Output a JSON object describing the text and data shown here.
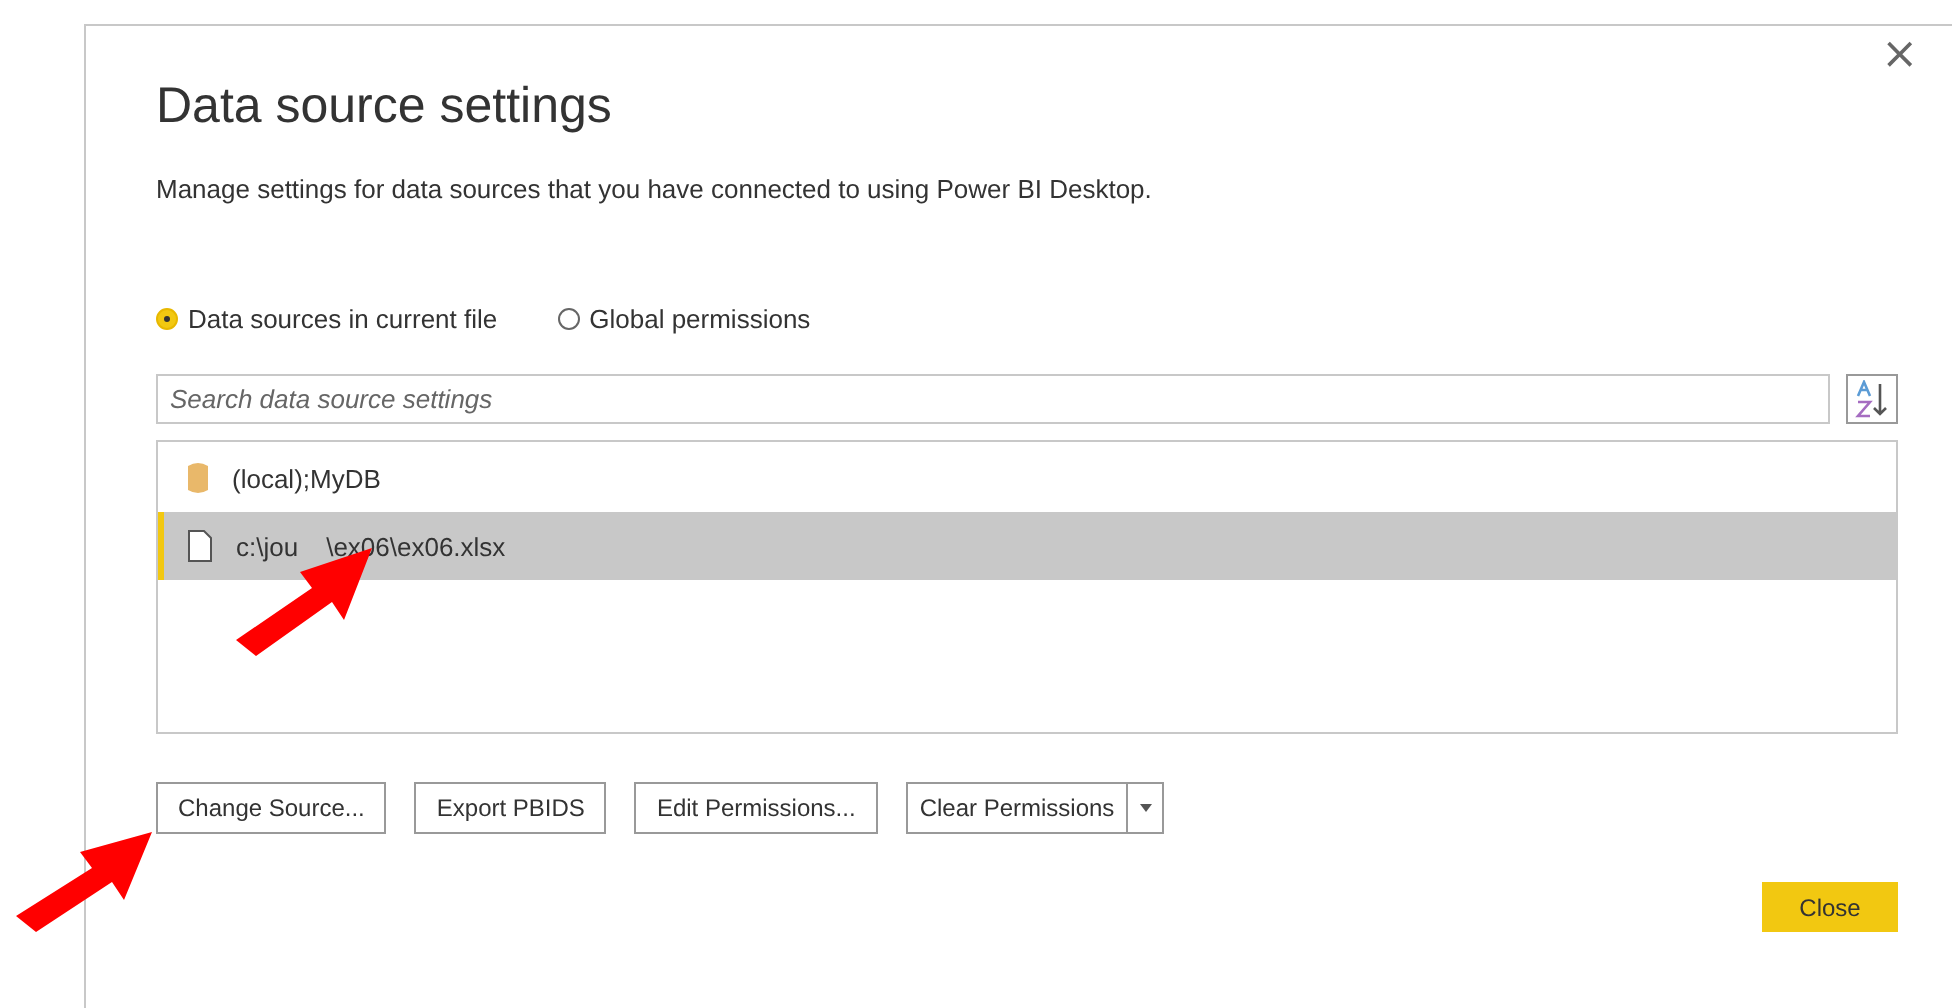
{
  "dialog": {
    "title": "Data source settings",
    "close_glyph": "×",
    "description": "Manage settings for data sources that you have connected to using Power BI Desktop."
  },
  "scope_options": [
    {
      "label": "Data sources in current file",
      "selected": true
    },
    {
      "label": "Global permissions",
      "selected": false
    }
  ],
  "search": {
    "placeholder": "Search data source settings"
  },
  "sources": [
    {
      "kind": "database",
      "label_start": "(local);MyDB",
      "selected": false
    },
    {
      "kind": "file",
      "label_start": "c:\\jou",
      "label_end": "\\ex06\\ex06.xlsx",
      "selected": true
    }
  ],
  "buttons": [
    {
      "label": "Change Source...",
      "dropdown": false
    },
    {
      "label": "Export PBIDS",
      "dropdown": false
    },
    {
      "label": "Edit Permissions...",
      "dropdown": false
    },
    {
      "label": "Clear Permissions",
      "dropdown": true
    }
  ],
  "close_button": {
    "label": "Close"
  }
}
